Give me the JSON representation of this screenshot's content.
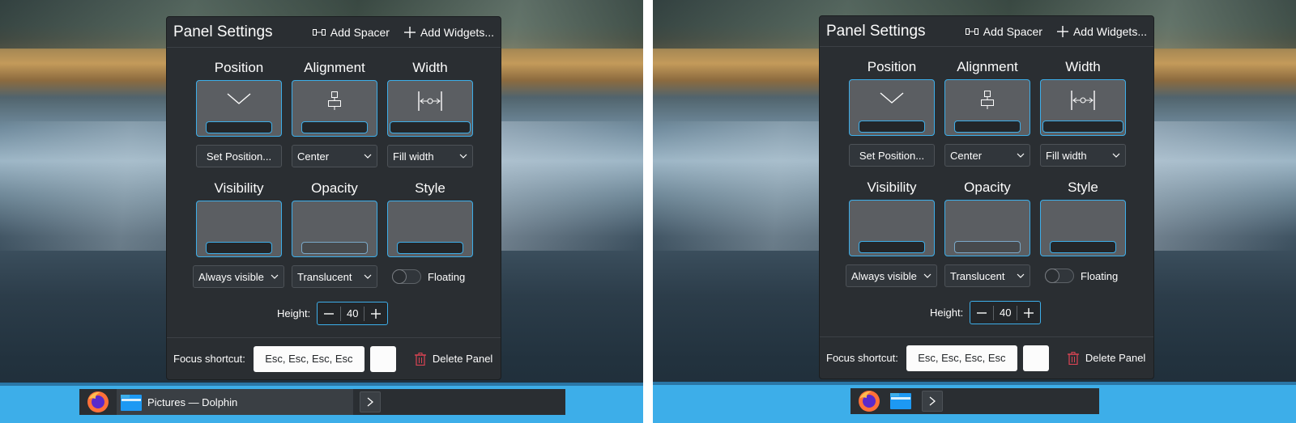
{
  "dialog": {
    "title": "Panel Settings",
    "add_spacer_label": "Add Spacer",
    "add_widgets_label": "Add Widgets...",
    "sections": {
      "position": {
        "label": "Position",
        "button": "Set Position..."
      },
      "alignment": {
        "label": "Alignment",
        "value": "Center"
      },
      "width": {
        "label": "Width",
        "value": "Fill width"
      },
      "visibility": {
        "label": "Visibility",
        "value": "Always visible"
      },
      "opacity": {
        "label": "Opacity",
        "value": "Translucent"
      },
      "style": {
        "label": "Style",
        "toggle_label": "Floating",
        "floating": false
      }
    },
    "height": {
      "label": "Height:",
      "value": "40"
    },
    "footer": {
      "shortcut_label": "Focus shortcut:",
      "shortcut_value": "Esc, Esc, Esc, Esc",
      "delete_label": "Delete Panel"
    }
  },
  "taskbar": {
    "left_task_label": "Pictures — Dolphin",
    "icons": [
      "firefox-icon",
      "dolphin-folder-icon",
      "chevron-right-icon"
    ]
  },
  "colors": {
    "accent": "#3daee9",
    "dialog_bg": "#2a2e32",
    "delete_icon": "#da4453",
    "taskbar": "#3daee9"
  }
}
